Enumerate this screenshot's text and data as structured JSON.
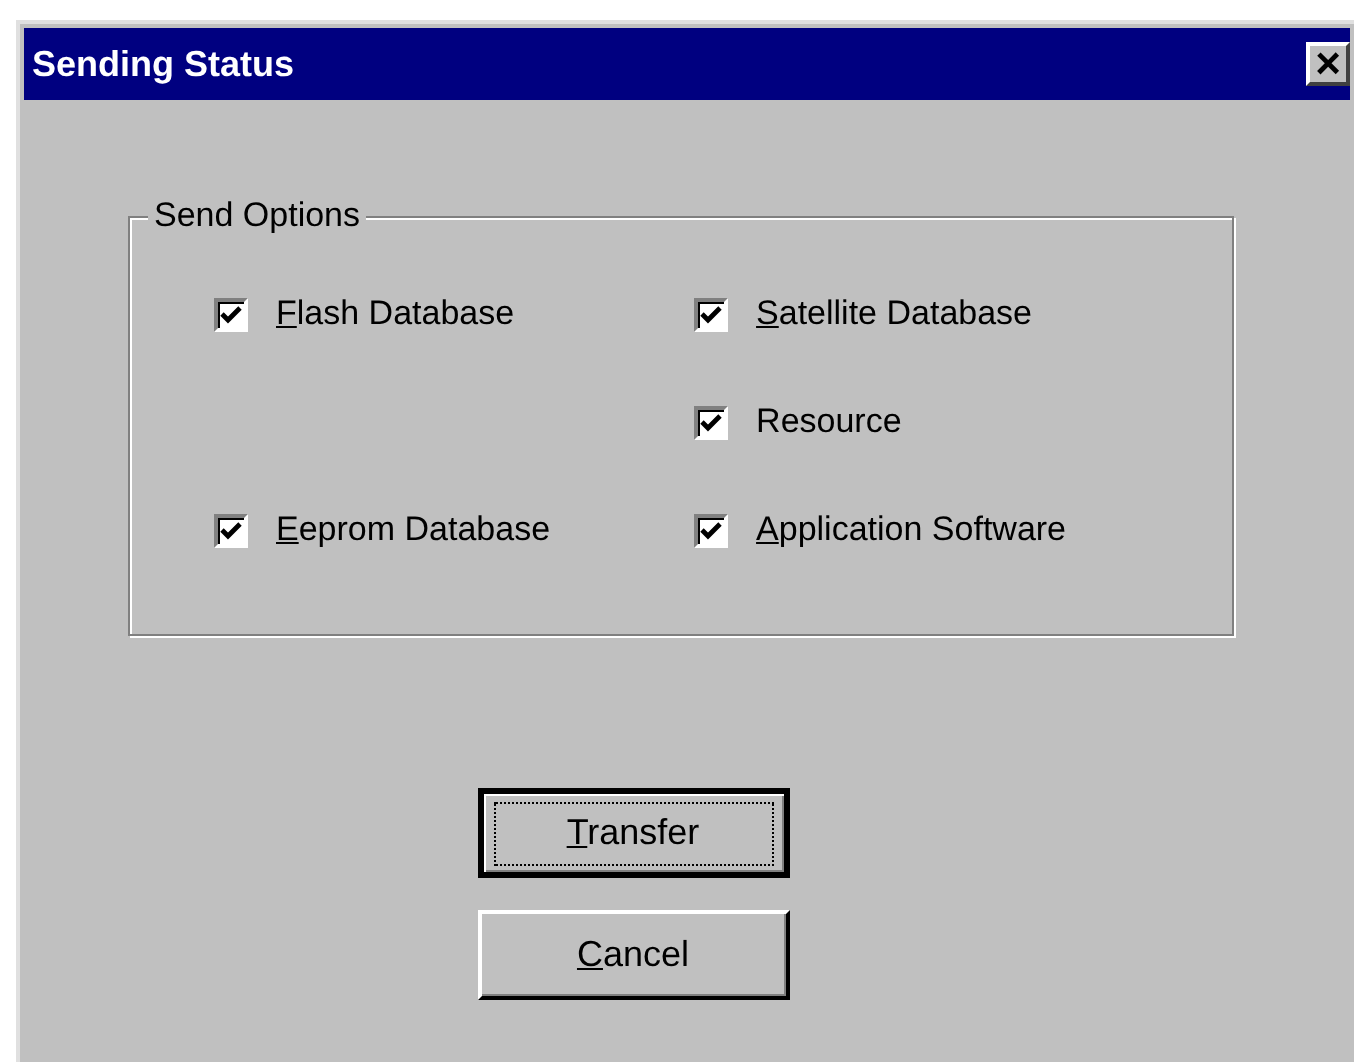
{
  "window": {
    "title": "Sending Status",
    "close": "×"
  },
  "group": {
    "legend": "Send Options",
    "columns": [
      {
        "options": [
          {
            "label": "Flash Database",
            "checked": true,
            "mnemonic_first": true
          },
          {
            "label": "Eeprom Database",
            "checked": true,
            "mnemonic_first": true
          }
        ]
      },
      {
        "options": [
          {
            "label": "Satellite Database",
            "checked": true,
            "mnemonic_first": true
          },
          {
            "label": "Resource",
            "checked": true,
            "mnemonic_first": false
          },
          {
            "label": "Application Software",
            "checked": true,
            "mnemonic_first": true
          }
        ]
      }
    ]
  },
  "buttons": [
    {
      "label": "Transfer",
      "default": true,
      "mnemonic_first": true
    },
    {
      "label": "Cancel",
      "default": false,
      "mnemonic_first": true
    }
  ]
}
